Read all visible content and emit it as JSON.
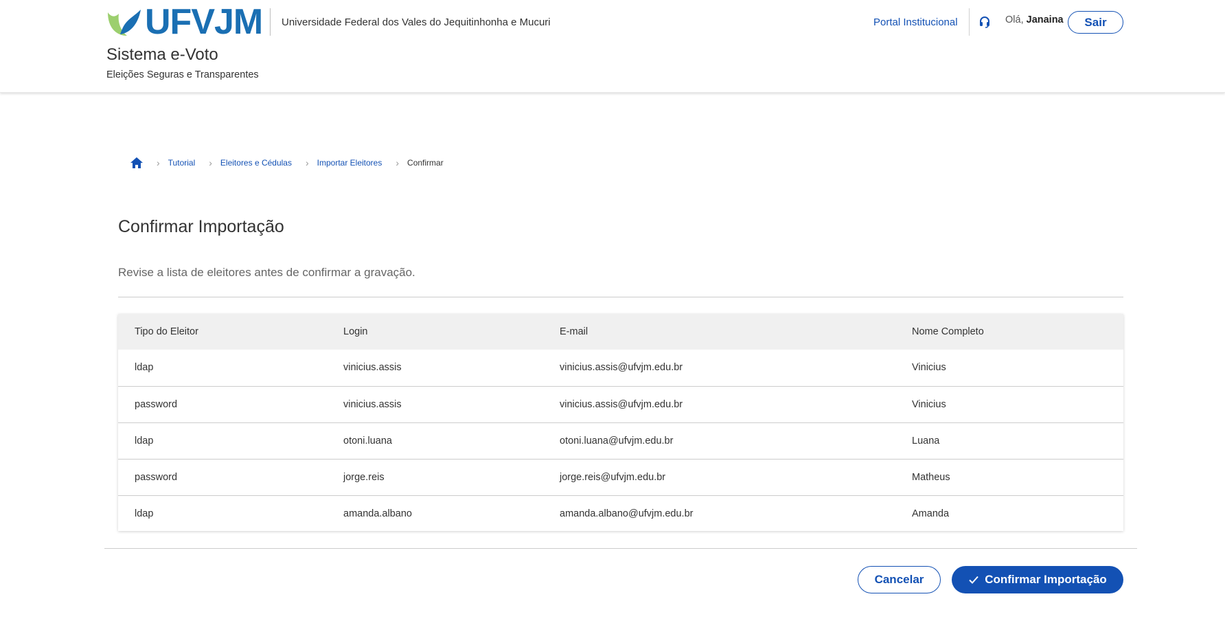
{
  "header": {
    "logo_text": "UFVJM",
    "university_name": "Universidade Federal dos Vales do Jequitinhonha e Mucuri",
    "system_title": "Sistema e-Voto",
    "system_subtitle": "Eleições Seguras e Transparentes",
    "portal_link": "Portal Institucional",
    "help_icon": "headset-icon",
    "greeting_prefix": "Olá,",
    "user_name": "Janaina",
    "logout_label": "Sair"
  },
  "breadcrumb": {
    "home_icon": "home-icon",
    "items": [
      "Tutorial",
      "Eleitores e Cédulas",
      "Importar Eleitores"
    ],
    "current": "Confirmar"
  },
  "main": {
    "title": "Confirmar Importação",
    "intro": "Revise a lista de eleitores antes de confirmar a gravação."
  },
  "table": {
    "headers": [
      "Tipo do Eleitor",
      "Login",
      "E-mail",
      "Nome Completo"
    ],
    "rows": [
      [
        "ldap",
        "vinicius.assis",
        "vinicius.assis@ufvjm.edu.br",
        "Vinicius"
      ],
      [
        "password",
        "vinicius.assis",
        "vinicius.assis@ufvjm.edu.br",
        "Vinicius"
      ],
      [
        "ldap",
        "otoni.luana",
        "otoni.luana@ufvjm.edu.br",
        "Luana"
      ],
      [
        "password",
        "jorge.reis",
        "jorge.reis@ufvjm.edu.br",
        "Matheus"
      ],
      [
        "ldap",
        "amanda.albano",
        "amanda.albano@ufvjm.edu.br",
        "Amanda"
      ]
    ]
  },
  "actions": {
    "cancel_label": "Cancelar",
    "confirm_label": "Confirmar Importação",
    "confirm_icon": "check-icon"
  },
  "colors": {
    "primary": "#1351b4",
    "logo_blue": "#1a6fb3",
    "logo_green": "#9ccf6e"
  }
}
